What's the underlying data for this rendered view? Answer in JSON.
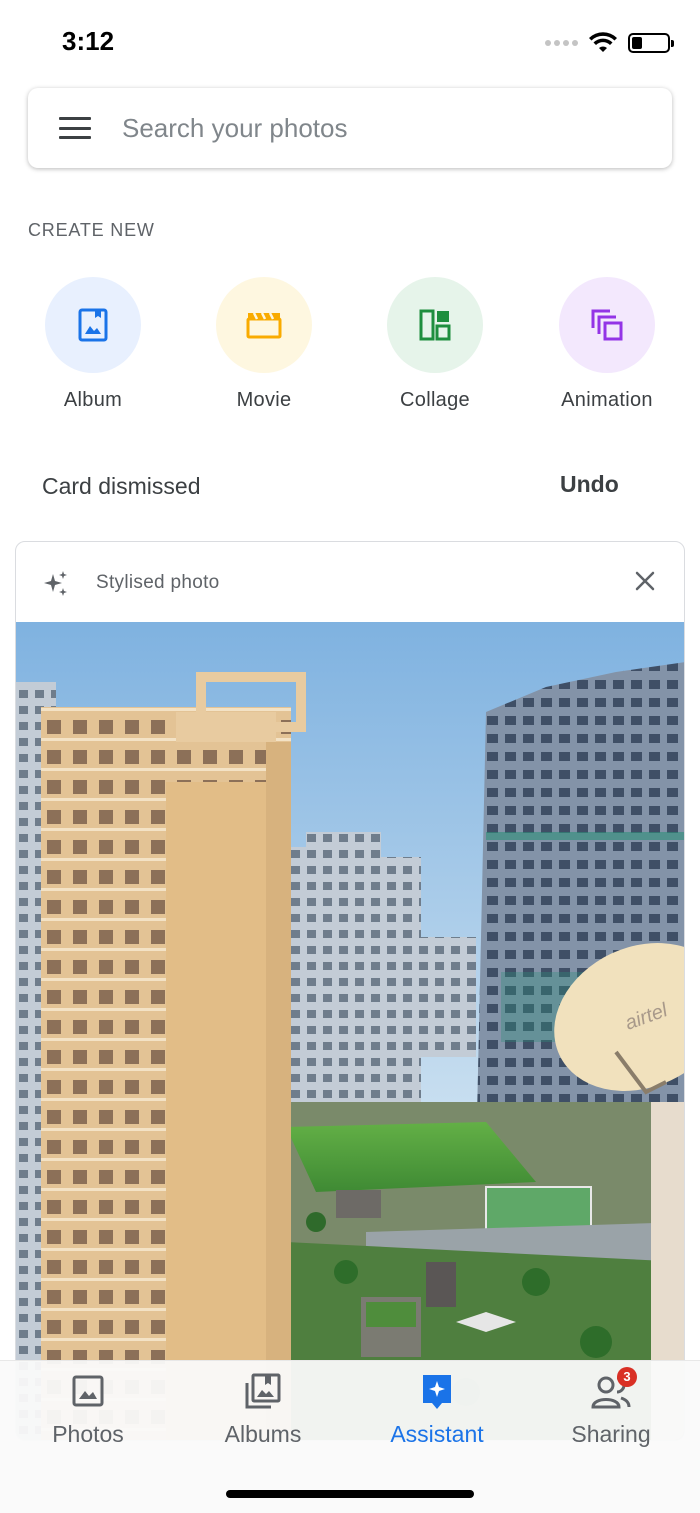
{
  "status_bar": {
    "time": "3:12"
  },
  "search": {
    "placeholder": "Search your photos"
  },
  "create_new": {
    "title": "CREATE NEW",
    "items": [
      {
        "label": "Album",
        "icon": "album-icon",
        "bg": "#e8f0fe",
        "color": "#1a73e8"
      },
      {
        "label": "Movie",
        "icon": "movie-icon",
        "bg": "#fef7e0",
        "color": "#f9ab00"
      },
      {
        "label": "Collage",
        "icon": "collage-icon",
        "bg": "#e6f4ea",
        "color": "#1e8e3e"
      },
      {
        "label": "Animation",
        "icon": "animation-icon",
        "bg": "#f3e8fd",
        "color": "#9334e6"
      }
    ]
  },
  "dismissed": {
    "text": "Card dismissed",
    "undo_label": "Undo"
  },
  "card": {
    "title": "Stylised photo",
    "photo_text": "airtel"
  },
  "bottom_nav": {
    "items": [
      {
        "label": "Photos",
        "icon": "photos-icon",
        "active": false
      },
      {
        "label": "Albums",
        "icon": "albums-icon",
        "active": false
      },
      {
        "label": "Assistant",
        "icon": "assistant-icon",
        "active": true
      },
      {
        "label": "Sharing",
        "icon": "sharing-icon",
        "active": false,
        "badge": "3"
      }
    ]
  },
  "colors": {
    "accent": "#1a73e8",
    "badge": "#d93025"
  }
}
